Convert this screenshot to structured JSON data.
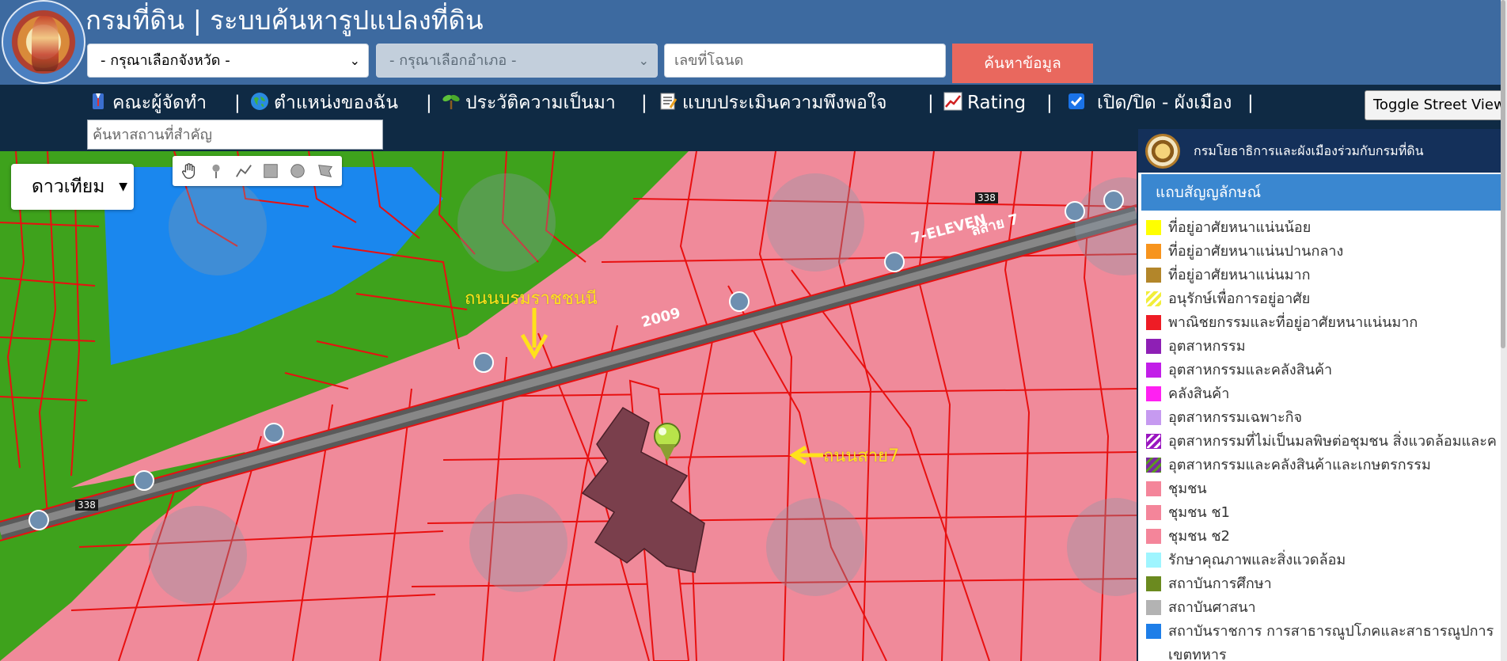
{
  "header": {
    "title": "กรมที่ดิน | ระบบค้นหารูปแปลงที่ดิน",
    "province_select": "- กรุณาเลือกจังหวัด -",
    "district_select": "- กรุณาเลือกอำเภอ -",
    "deed_placeholder": "เลขที่โฉนด",
    "search_button": "ค้นหาข้อมูล"
  },
  "nav": {
    "items": [
      {
        "label": "คณะผู้จัดทำ",
        "icon": "team-icon"
      },
      {
        "label": "ตำแหน่งของฉัน",
        "icon": "globe-icon"
      },
      {
        "label": "ประวัติความเป็นมา",
        "icon": "sprout-icon"
      },
      {
        "label": "แบบประเมินความพึงพอใจ",
        "icon": "memo-icon"
      },
      {
        "label": "Rating",
        "icon": "chart-icon"
      }
    ],
    "city_plan_toggle": {
      "label": "เปิด/ปิด - ผังเมือง",
      "checked": true
    },
    "separator": "|",
    "landmark_placeholder": "ค้นหาสถานที่สำคัญ",
    "street_view_button": "Toggle Street View"
  },
  "map": {
    "layer_select": "ดาวเทียม",
    "tools": [
      "hand-icon",
      "marker-icon",
      "polyline-icon",
      "rectangle-icon",
      "circle-icon",
      "polygon-icon"
    ],
    "annotations": {
      "road_main": "ถนนบรมราชชนนี",
      "road_sai7": "ถนนสาย7"
    },
    "labels": {
      "poi_7eleven": "7-ELEVEN",
      "road_sign_338": "338",
      "road_2009": "2009",
      "sai7_tail": "ลสาย 7"
    }
  },
  "legend": {
    "org": "กรมโยธาธิการและผังเมืองร่วมกับกรมที่ดิน",
    "title": "แถบสัญญลักษณ์",
    "items": [
      {
        "label": "ที่อยู่อาศัยหนาแน่นน้อย",
        "color": "#ffff00"
      },
      {
        "label": "ที่อยู่อาศัยหนาแน่นปานกลาง",
        "color": "#f7941d"
      },
      {
        "label": "ที่อยู่อาศัยหนาแน่นมาก",
        "color": "#b3862a"
      },
      {
        "label": "อนุรักษ์เพื่อการอยู่อาศัย",
        "color": "#f2ee3a",
        "pattern": "hatch-yellow"
      },
      {
        "label": "พาณิชยกรรมและที่อยู่อาศัยหนาแน่นมาก",
        "color": "#ee1c25"
      },
      {
        "label": "อุตสาหกรรม",
        "color": "#8e1fb5"
      },
      {
        "label": "อุตสาหกรรมและคลังสินค้า",
        "color": "#c21ee8"
      },
      {
        "label": "คลังสินค้า",
        "color": "#ff20f2"
      },
      {
        "label": "อุตสาหกรรมเฉพาะกิจ",
        "color": "#c69af0"
      },
      {
        "label": "อุตสาหกรรมที่ไม่เป็นมลพิษต่อชุมชน สิ่งแวดล้อมและค",
        "color": "#9a16c0",
        "pattern": "hatch-purple"
      },
      {
        "label": "อุตสาหกรรมและคลังสินค้าและเกษตรกรรม",
        "color": "#7a2aa0",
        "pattern": "hatch-green"
      },
      {
        "label": "ชุมชน",
        "color": "#f4859a"
      },
      {
        "label": "ชุมชน  ช1",
        "color": "#f4859a"
      },
      {
        "label": "ชุมชน  ช2",
        "color": "#f4859a"
      },
      {
        "label": "รักษาคุณภาพและสิ่งแวดล้อม",
        "color": "#9ff5ff"
      },
      {
        "label": "สถาบันการศึกษา",
        "color": "#6b8a1f"
      },
      {
        "label": "สถาบันศาสนา",
        "color": "#b3b3b3"
      },
      {
        "label": "สถาบันราชการ การสาธารณูปโภคและสาธารณูปการ",
        "color": "#1e7ee8"
      }
    ],
    "trailing_text": "เขตทหาร"
  }
}
